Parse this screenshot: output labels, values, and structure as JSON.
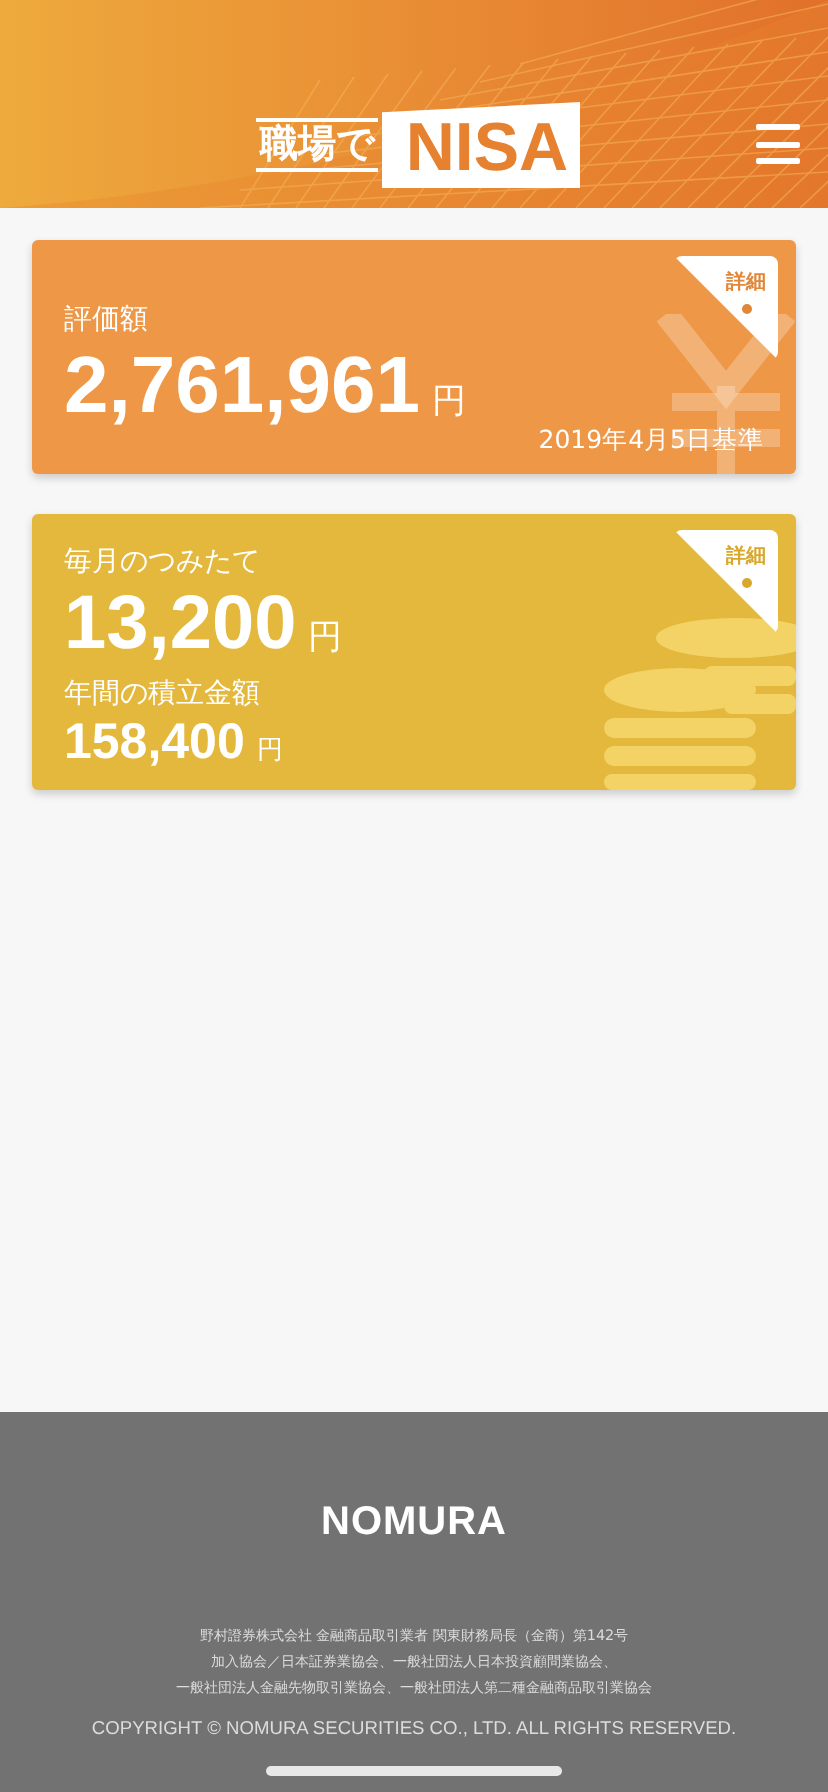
{
  "header": {
    "logo_prefix": "職場で",
    "logo_main": "NISA"
  },
  "cards": [
    {
      "kind": "valuation",
      "color": "#ee9747",
      "label": "評価額",
      "amount": "2,761,961",
      "unit": "円",
      "date": "2019年4月5日基準",
      "detail": "詳細"
    },
    {
      "kind": "monthly",
      "color": "#e4b83d",
      "label": "毎月のつみたて",
      "amount": "13,200",
      "unit": "円",
      "sub_label": "年間の積立金額",
      "sub_amount": "158,400",
      "sub_unit": "円",
      "detail": "詳細"
    }
  ],
  "footer": {
    "brand": "NOMURA",
    "lines": [
      "野村證券株式会社 金融商品取引業者 関東財務局長（金商）第142号",
      "加入協会／日本証券業協会、一般社団法人日本投資顧問業協会、",
      "一般社団法人金融先物取引業協会、一般社団法人第二種金融商品取引業協会"
    ],
    "copyright": "COPYRIGHT © NOMURA SECURITIES CO., LTD. ALL RIGHTS RESERVED."
  }
}
